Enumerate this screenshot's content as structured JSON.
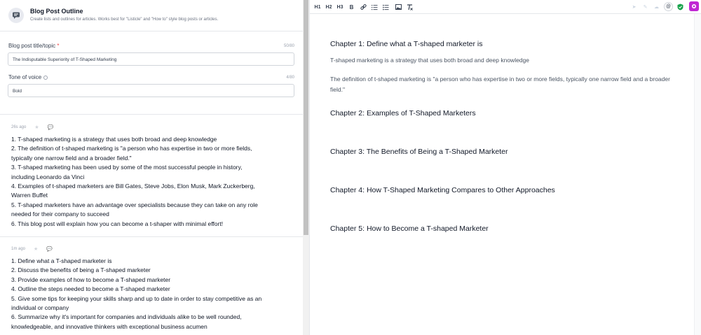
{
  "tool": {
    "title": "Blog Post Outline",
    "description": "Create lists and outlines for articles. Works best for \"Listicle\" and \"How to\" style blog posts or articles."
  },
  "form": {
    "title_label": "Blog post title/topic",
    "required_mark": "*",
    "title_count": "50/80",
    "title_value": "The Indisputable Superiority of T-Shaped Marketing",
    "tone_label": "Tone of voice",
    "tone_count": "4/80",
    "tone_value": "Bold"
  },
  "results": [
    {
      "time": "26s ago",
      "lines": [
        "1. T-shaped marketing is a strategy that uses both broad and deep knowledge",
        "2. The definition of t-shaped marketing is \"a person who has expertise in two or more fields,",
        "typically one narrow field and a broader field.\"",
        "3. T-shaped marketing has been used by some of the most successful people in history,",
        "including Leonardo da Vinci",
        "4. Examples of t-shaped marketers are Bill Gates, Steve Jobs, Elon Musk, Mark Zuckerberg,",
        "Warren Buffet",
        "5. T-shaped marketers have an advantage over specialists because they can take on any role",
        "needed for their company to succeed",
        "6. This blog post will explain how you can become a t-shaper with minimal effort!"
      ]
    },
    {
      "time": "1m ago",
      "lines": [
        "1. Define what a T-shaped marketer is",
        "2. Discuss the benefits of being a T-shaped marketer",
        "3. Provide examples of how to become a T-shaped marketer",
        "4. Outline the steps needed to become a T-shaped marketer",
        "5. Give some tips for keeping your skills sharp and up to date in order to stay competitive as an",
        "individual or company",
        "6. Summarize why it's important for companies and individuals alike to be well rounded,",
        "knowledgeable, and innovative thinkers with exceptional business acumen"
      ]
    }
  ],
  "toolbar": {
    "h1": "H1",
    "h2": "H2",
    "h3": "H3",
    "bold": "B"
  },
  "document": {
    "chapter1_title": "Chapter 1: Define what a T-shaped marketer is",
    "chapter1_p1": "T-shaped marketing is a strategy that uses both broad and deep knowledge",
    "chapter1_p2": "The definition of t-shaped marketing is \"a person who has expertise in two or more fields, typically one narrow field and a broader field.\"",
    "chapter2_title": "Chapter 2: Examples of T-Shaped Marketers",
    "chapter3_title": "Chapter 3: The Benefits of Being a T-Shaped Marketer",
    "chapter4_title": "Chapter 4: How T-Shaped Marketing Compares to Other Approaches",
    "chapter5_title": "Chapter 5: How to Become a T-shaped Marketer"
  },
  "colors": {
    "accent_purple": "#c026d3",
    "shield_green": "#16a34a",
    "required_red": "#ef4444"
  }
}
